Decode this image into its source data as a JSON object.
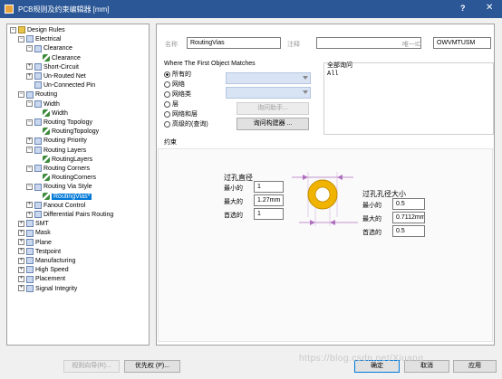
{
  "window": {
    "title": "PCB规则及约束编辑器 [mm]",
    "help_label": "?",
    "close_label": "✕"
  },
  "tree": [
    {
      "level": 0,
      "expander": "−",
      "icon": "folder",
      "label": "Design Rules"
    },
    {
      "level": 1,
      "expander": "−",
      "icon": "cat",
      "label": "Electrical"
    },
    {
      "level": 2,
      "expander": "−",
      "icon": "cat",
      "label": "Clearance"
    },
    {
      "level": 3,
      "expander": "",
      "icon": "rule",
      "label": "Clearance"
    },
    {
      "level": 2,
      "expander": "+",
      "icon": "cat",
      "label": "Short-Circuit"
    },
    {
      "level": 2,
      "expander": "+",
      "icon": "cat",
      "label": "Un-Routed Net"
    },
    {
      "level": 2,
      "expander": "",
      "icon": "cat",
      "label": "Un-Connected Pin"
    },
    {
      "level": 1,
      "expander": "−",
      "icon": "cat",
      "label": "Routing"
    },
    {
      "level": 2,
      "expander": "−",
      "icon": "cat",
      "label": "Width"
    },
    {
      "level": 3,
      "expander": "",
      "icon": "rule",
      "label": "Width"
    },
    {
      "level": 2,
      "expander": "−",
      "icon": "cat",
      "label": "Routing Topology"
    },
    {
      "level": 3,
      "expander": "",
      "icon": "rule",
      "label": "RoutingTopology"
    },
    {
      "level": 2,
      "expander": "+",
      "icon": "cat",
      "label": "Routing Priority"
    },
    {
      "level": 2,
      "expander": "−",
      "icon": "cat",
      "label": "Routing Layers"
    },
    {
      "level": 3,
      "expander": "",
      "icon": "rule",
      "label": "RoutingLayers"
    },
    {
      "level": 2,
      "expander": "−",
      "icon": "cat",
      "label": "Routing Corners"
    },
    {
      "level": 3,
      "expander": "",
      "icon": "rule",
      "label": "RoutingCorners"
    },
    {
      "level": 2,
      "expander": "−",
      "icon": "cat",
      "label": "Routing Via Style"
    },
    {
      "level": 3,
      "expander": "",
      "icon": "rule",
      "label": "RoutingVias*",
      "selected": true
    },
    {
      "level": 2,
      "expander": "+",
      "icon": "cat",
      "label": "Fanout Control"
    },
    {
      "level": 2,
      "expander": "+",
      "icon": "cat",
      "label": "Differential Pairs Routing"
    },
    {
      "level": 1,
      "expander": "+",
      "icon": "cat",
      "label": "SMT"
    },
    {
      "level": 1,
      "expander": "+",
      "icon": "cat",
      "label": "Mask"
    },
    {
      "level": 1,
      "expander": "+",
      "icon": "cat",
      "label": "Plane"
    },
    {
      "level": 1,
      "expander": "+",
      "icon": "cat",
      "label": "Testpoint"
    },
    {
      "level": 1,
      "expander": "+",
      "icon": "cat",
      "label": "Manufacturing"
    },
    {
      "level": 1,
      "expander": "+",
      "icon": "cat",
      "label": "High Speed"
    },
    {
      "level": 1,
      "expander": "+",
      "icon": "cat",
      "label": "Placement"
    },
    {
      "level": 1,
      "expander": "+",
      "icon": "cat",
      "label": "Signal Integrity"
    }
  ],
  "header": {
    "name_label": "名称",
    "name_value": "RoutingVias",
    "comment_label": "注释",
    "comment_value": "",
    "id_label": "唯一ID",
    "id_value": "OWVMTUSM"
  },
  "where": {
    "title": "Where The First Object Matches",
    "options": [
      "所有的",
      "网络",
      "网络类",
      "层",
      "网络和层",
      "高级的(查询)"
    ],
    "selected_index": 0,
    "query_helper_label": "询问助手...",
    "query_builder_label": "询问构建器 ...",
    "full_query_title": "全部询问",
    "full_query_value": "All"
  },
  "constraints": {
    "title": "约束",
    "via_diameter_title": "过孔直径",
    "via_hole_title": "过孔孔径大小",
    "min_label": "最小的",
    "max_label": "最大的",
    "preferred_label": "首选的",
    "diameter_min": "1",
    "diameter_max": "1.27mm",
    "diameter_preferred": "1",
    "hole_min": "0.5",
    "hole_max": "0.7112mm",
    "hole_preferred": "0.5"
  },
  "bottom": {
    "rule_wizard_label": "规则向导(R)...",
    "priorities_label": "优先权 (P)...",
    "ok_label": "确定",
    "cancel_label": "取消",
    "apply_label": "应用"
  },
  "watermark": "https://blog.csdn.net/Xiuang",
  "colors": {
    "titlebar": "#2b5797",
    "selection": "#0078d7",
    "via_ring": "#f0b400"
  }
}
